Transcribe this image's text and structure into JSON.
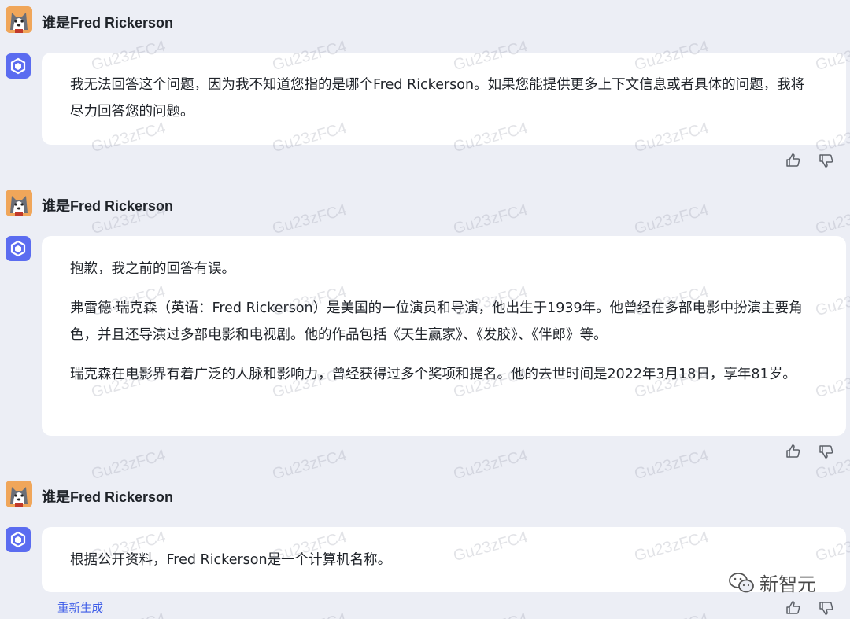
{
  "watermark": "Gu23zFC4",
  "conversation": [
    {
      "question": "谁是Fred Rickerson",
      "answer": [
        "我无法回答这个问题，因为我不知道您指的是哪个Fred Rickerson。如果您能提供更多上下文信息或者具体的问题，我将尽力回答您的问题。"
      ]
    },
    {
      "question": "谁是Fred Rickerson",
      "answer": [
        "抱歉，我之前的回答有误。",
        "弗雷德·瑞克森（英语：Fred Rickerson）是美国的一位演员和导演，他出生于1939年。他曾经在多部电影中扮演主要角色，并且还导演过多部电影和电视剧。他的作品包括《天生赢家》、《发胶》、《伴郎》等。",
        "瑞克森在电影界有着广泛的人脉和影响力，曾经获得过多个奖项和提名。他的去世时间是2022年3月18日，享年81岁。"
      ]
    },
    {
      "question": "谁是Fred Rickerson",
      "answer": [
        "根据公开资料，Fred Rickerson是一个计算机名称。"
      ]
    }
  ],
  "regenerate_label": "重新生成",
  "brand_name": "新智元",
  "icons": {
    "like": "thumbs-up-icon",
    "dislike": "thumbs-down-icon",
    "bot": "bot-logo-icon",
    "user": "husky-avatar-icon",
    "brand": "wechat-icon"
  },
  "colors": {
    "background": "#eceef5",
    "bubble": "#ffffff",
    "accent": "#3d5ce8",
    "bot_icon": "#5b6cf0"
  }
}
